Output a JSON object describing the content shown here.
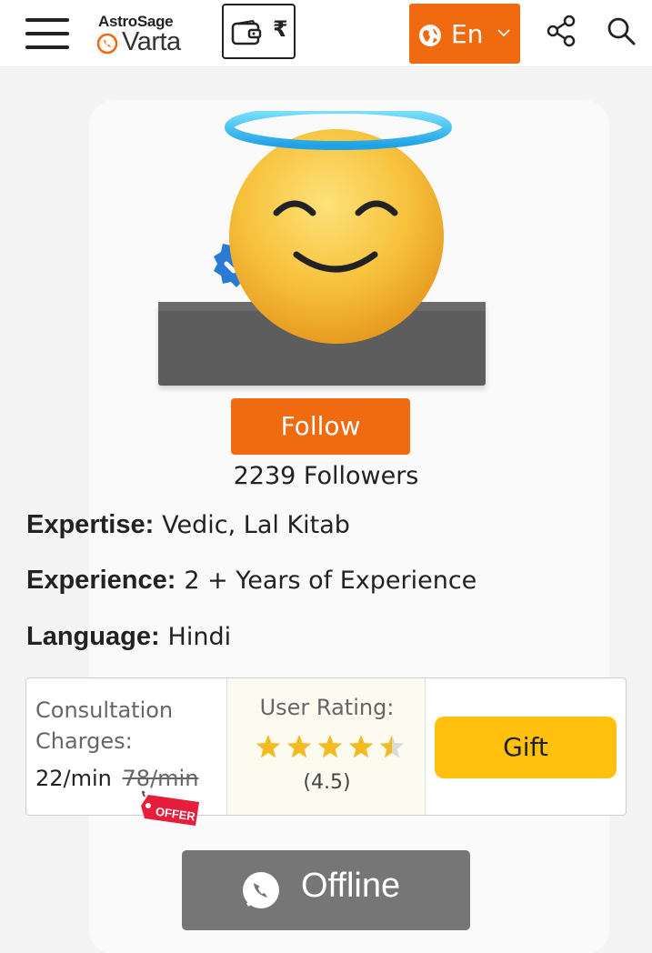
{
  "header": {
    "menu_icon": "hamburger-menu-icon",
    "logo_top": "AstroSage",
    "logo_bottom": "Varta",
    "wallet_icon": "wallet-icon",
    "currency_symbol": "₹",
    "language_label": "En",
    "share_icon": "share-icon",
    "search_icon": "search-icon",
    "accent_color": "#f06a10"
  },
  "profile": {
    "avatar_icon": "smiling-halo-emoji",
    "verified_icon": "verified-badge-icon",
    "follow_label": "Follow",
    "followers_text": "2239 Followers"
  },
  "details": {
    "expertise_label": "Expertise:",
    "expertise_value": "Vedic, Lal Kitab",
    "experience_label": "Experience:",
    "experience_value": "2 + Years of Experience",
    "language_label": "Language:",
    "language_value": "Hindi"
  },
  "stats": {
    "charges_label": "Consultation Charges:",
    "price_current": "22/min",
    "price_old": "78/min",
    "offer_label": "OFFER",
    "rating_label": "User Rating:",
    "rating_stars": 4.5,
    "rating_max": 5,
    "rating_value": "(4.5)",
    "gift_label": "Gift",
    "gift_color": "#ffc10e"
  },
  "status": {
    "offline_label": "Offline",
    "chat_icon": "chat-bubble-icon",
    "offline_color": "#767676"
  }
}
